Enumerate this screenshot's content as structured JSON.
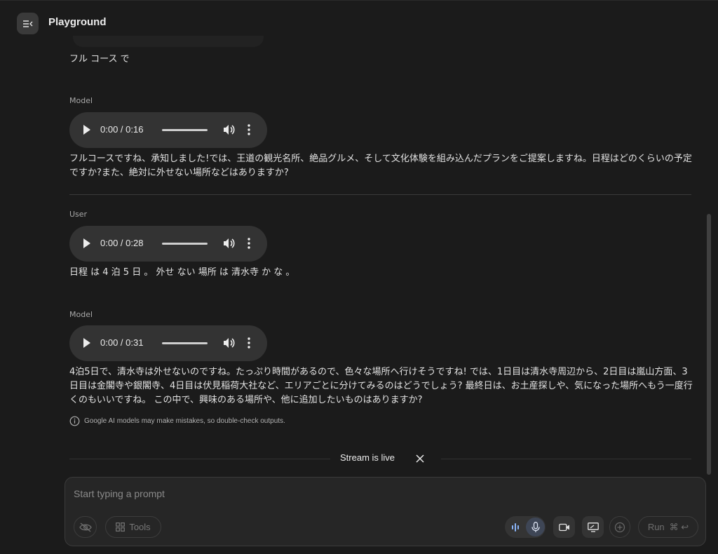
{
  "header": {
    "title": "Playground"
  },
  "conversation": {
    "previous_user_text": "フル コース で",
    "messages": [
      {
        "role": "Model",
        "audio_time": "0:00 / 0:16",
        "text": "フルコースですね、承知しました!では、王道の観光名所、絶品グルメ、そして文化体験を組み込んだプランをご提案しますね。日程はどのくらいの予定ですか?また、絶対に外せない場所などはありますか?"
      },
      {
        "role": "User",
        "audio_time": "0:00 / 0:28",
        "text": "日程 は 4 泊 5 日 。 外せ ない 場所 は 清水寺 か な 。"
      },
      {
        "role": "Model",
        "audio_time": "0:00 / 0:31",
        "text": "4泊5日で、清水寺は外せないのですね。たっぷり時間があるので、色々な場所へ行けそうですね! では、1日目は清水寺周辺から、2日目は嵐山方面、3日目は金閣寺や銀閣寺、4日目は伏見稲荷大社など、エリアごとに分けてみるのはどうでしょう? 最終日は、お土産探しや、気になった場所へもう一度行くのもいいですね。 この中で、興味のある場所や、他に追加したいものはありますか?"
      }
    ],
    "disclaimer": "Google AI models may make mistakes, so double-check outputs.",
    "stream_status": "Stream is live"
  },
  "composer": {
    "placeholder": "Start typing a prompt",
    "tools_label": "Tools",
    "run_label": "Run",
    "run_shortcut": "⌘ ↩"
  },
  "colors": {
    "background": "#1b1b1b",
    "surface": "#262626",
    "audio_pill": "#333333",
    "active_mic": "#3e4656",
    "wave_accent": "#8ab4f8"
  },
  "icons": {
    "menu": "menu-collapse-icon",
    "play": "play-icon",
    "volume": "volume-icon",
    "more": "more-vert-icon",
    "info": "info-icon",
    "close": "close-icon",
    "no-eye": "visibility-off-icon",
    "tools": "grid-icon",
    "wave": "audio-wave-icon",
    "mic": "mic-icon",
    "camera": "videocam-icon",
    "screen": "screen-share-icon",
    "add": "add-circle-icon"
  }
}
